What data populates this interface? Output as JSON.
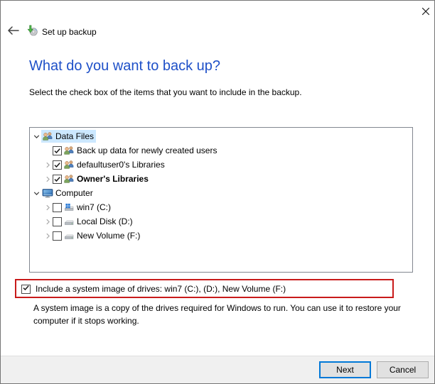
{
  "window": {
    "title": "Set up backup"
  },
  "heading": "What do you want to back up?",
  "instruction": "Select the check box of the items that you want to include in the backup.",
  "tree": {
    "items": [
      {
        "label": "Data Files",
        "level": 0,
        "expander": "expanded",
        "icon": "users-icon",
        "selected": true
      },
      {
        "label": "Back up data for newly created users",
        "level": 1,
        "expander": "none",
        "checkbox": "checked",
        "icon": "users-icon"
      },
      {
        "label": "defaultuser0's Libraries",
        "level": 1,
        "expander": "collapsed",
        "checkbox": "checked",
        "icon": "users-icon"
      },
      {
        "label": "Owner's Libraries",
        "level": 1,
        "expander": "collapsed",
        "checkbox": "checked",
        "icon": "users-icon",
        "bold": true
      },
      {
        "label": "Computer",
        "level": 0,
        "expander": "expanded",
        "icon": "computer-icon"
      },
      {
        "label": "win7 (C:)",
        "level": 1,
        "expander": "collapsed",
        "checkbox": "unchecked",
        "icon": "system-drive-icon"
      },
      {
        "label": "Local Disk (D:)",
        "level": 1,
        "expander": "collapsed",
        "checkbox": "unchecked",
        "icon": "drive-icon"
      },
      {
        "label": "New Volume (F:)",
        "level": 1,
        "expander": "collapsed",
        "checkbox": "unchecked",
        "icon": "drive-icon"
      }
    ]
  },
  "system_image": {
    "label": "Include a system image of drives: win7 (C:), (D:), New Volume (F:)",
    "checked": true,
    "note": "A system image is a copy of the drives required for Windows to run. You can use it to restore your computer if it stops working."
  },
  "footer": {
    "next_label": "Next",
    "cancel_label": "Cancel"
  },
  "colors": {
    "heading": "#1E50C8",
    "selection": "#CCE8FF",
    "annotation": "#C81A1A",
    "focus": "#0078D7"
  }
}
